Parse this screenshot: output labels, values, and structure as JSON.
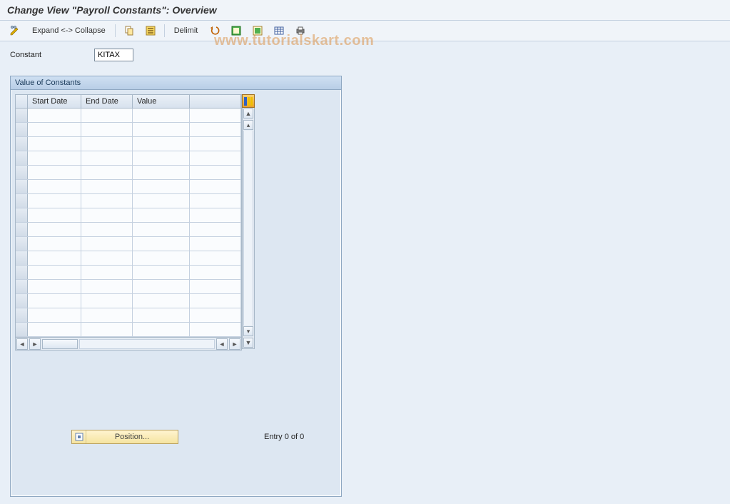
{
  "title": "Change View \"Payroll Constants\": Overview",
  "toolbar": {
    "expand_collapse": "Expand <-> Collapse",
    "delimit": "Delimit"
  },
  "field": {
    "constant_label": "Constant",
    "constant_value": "KITAX"
  },
  "panel": {
    "title": "Value of Constants",
    "columns": [
      "Start Date",
      "End Date",
      "Value"
    ],
    "row_count": 16
  },
  "footer": {
    "position_label": "Position...",
    "entry_text": "Entry 0 of 0"
  },
  "watermark": "www.tutorialskart.com"
}
